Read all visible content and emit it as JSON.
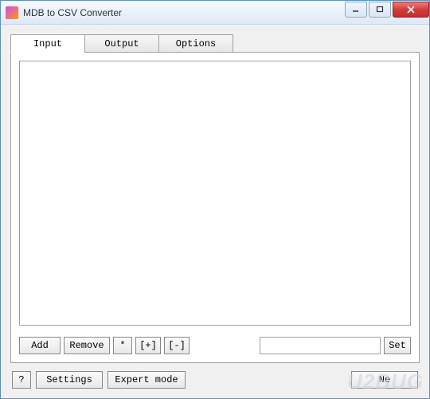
{
  "window": {
    "title": "MDB to CSV Converter"
  },
  "tabs": {
    "input": "Input",
    "output": "Output",
    "options": "Options"
  },
  "input_panel": {
    "add": "Add",
    "remove": "Remove",
    "wildcard": "*",
    "expand": "[+]",
    "collapse": "[-]",
    "path_value": "",
    "set": "Set"
  },
  "bottom": {
    "help": "?",
    "settings": "Settings",
    "expert": "Expert mode",
    "next": "Ne"
  },
  "watermark": "U2BUG"
}
